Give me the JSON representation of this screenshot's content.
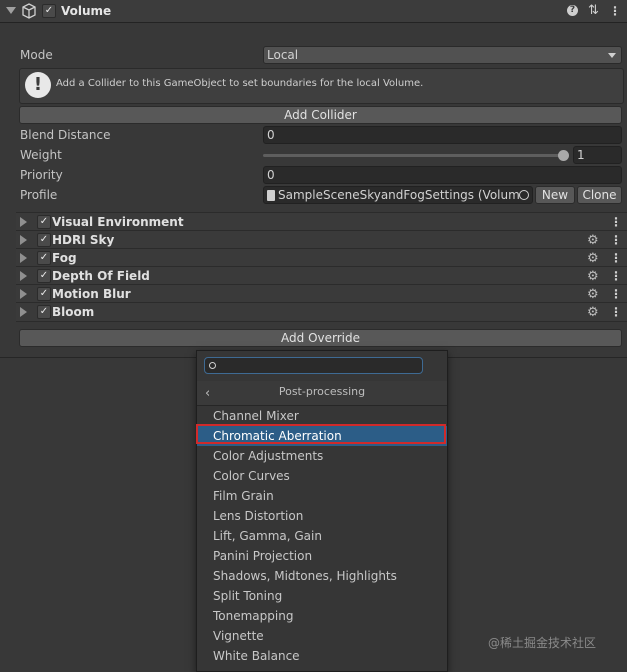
{
  "component": {
    "title": "Volume",
    "enabled": true
  },
  "mode": {
    "label": "Mode",
    "value": "Local"
  },
  "help": {
    "text": "Add a Collider to this GameObject to set boundaries for the local Volume."
  },
  "add_collider_label": "Add Collider",
  "blend_distance": {
    "label": "Blend Distance",
    "value": "0"
  },
  "weight": {
    "label": "Weight",
    "value": "1",
    "slider_fraction": 1.0
  },
  "priority": {
    "label": "Priority",
    "value": "0"
  },
  "profile": {
    "label": "Profile",
    "value": "SampleSceneSkyandFogSettings (Volume",
    "new_label": "New",
    "clone_label": "Clone"
  },
  "overrides": [
    {
      "name": "Visual Environment",
      "enabled": true,
      "has_gear": false
    },
    {
      "name": "HDRI Sky",
      "enabled": true,
      "has_gear": true
    },
    {
      "name": "Fog",
      "enabled": true,
      "has_gear": true
    },
    {
      "name": "Depth Of Field",
      "enabled": true,
      "has_gear": true
    },
    {
      "name": "Motion Blur",
      "enabled": true,
      "has_gear": true
    },
    {
      "name": "Bloom",
      "enabled": true,
      "has_gear": true
    }
  ],
  "add_override_label": "Add Override",
  "popup": {
    "search_value": "",
    "category": "Post-processing",
    "items": [
      "Channel Mixer",
      "Chromatic Aberration",
      "Color Adjustments",
      "Color Curves",
      "Film Grain",
      "Lens Distortion",
      "Lift, Gamma, Gain",
      "Panini Projection",
      "Shadows, Midtones, Highlights",
      "Split Toning",
      "Tonemapping",
      "Vignette",
      "White Balance"
    ],
    "selected": "Chromatic Aberration"
  },
  "watermark": "@稀土掘金技术社区",
  "colors": {
    "selection": "#2c5d87",
    "highlight_border": "#d12a2a"
  }
}
